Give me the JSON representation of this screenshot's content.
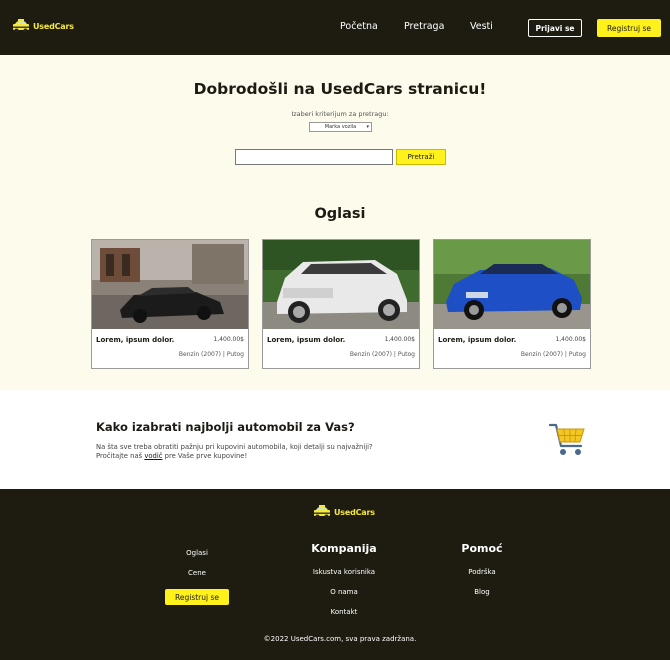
{
  "brand": {
    "name": "UsedCars"
  },
  "header": {
    "nav": [
      "Početna",
      "Pretraga",
      "Vesti"
    ],
    "login_label": "Prijavi se",
    "register_label": "Registruj se"
  },
  "hero": {
    "title": "Dobrodošli na UsedCars stranicu!",
    "criteria_label": "Izaberi kriterijum za pretragu:",
    "criteria_selected": "Marka vozila",
    "search_value": "",
    "search_button": "Pretraži"
  },
  "ads": {
    "title": "Oglasi",
    "cards": [
      {
        "name": "Lorem, ipsum dolor.",
        "price": "1,400.00$",
        "meta": "Benzin (2007) | Putog",
        "car_color": "#1b1b1b"
      },
      {
        "name": "Lorem, ipsum dolor.",
        "price": "1,400.00$",
        "meta": "Benzin (2007) | Putog",
        "car_color": "#e9e9e9"
      },
      {
        "name": "Lorem, ipsum dolor.",
        "price": "1,400.00$",
        "meta": "Benzin (2007) | Putog",
        "car_color": "#1f4fc4"
      }
    ]
  },
  "guide": {
    "title": "Kako izabrati najbolji automobil za Vas?",
    "line1": "Na šta sve treba obratiti pažnju pri kupovini automobila, koji detalji su najvažniji?",
    "line2_prefix": "Pročitajte naš",
    "line2_link": "vodič",
    "line2_suffix": "pre Vaše prve kupovine!"
  },
  "footer": {
    "col1": [
      "Oglasi",
      "Cene"
    ],
    "register_label": "Registruj se",
    "company_heading": "Kompanija",
    "company_links": [
      "Iskustva korisnika",
      "O nama",
      "Kontakt"
    ],
    "help_heading": "Pomoć",
    "help_links": [
      "Podrška",
      "Blog"
    ],
    "copyright": "©2022 UsedCars.com, sva prava zadržana."
  },
  "colors": {
    "dark": "#1e1c11",
    "accent": "#fff21c",
    "cream": "#fdfbeb"
  }
}
